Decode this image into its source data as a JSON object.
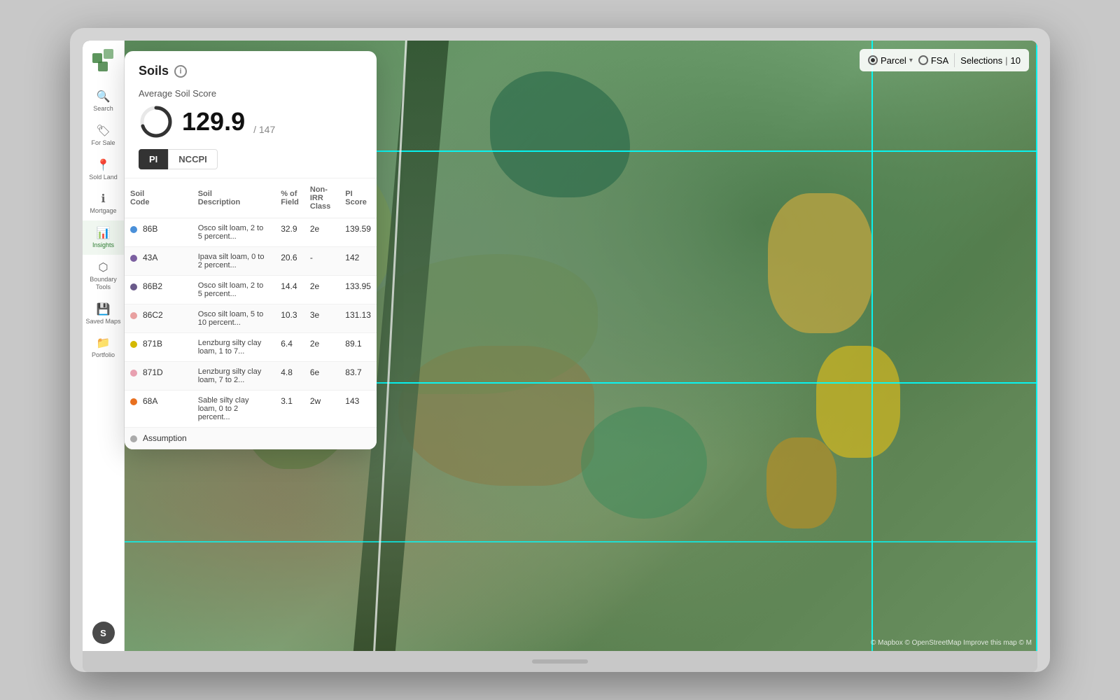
{
  "app": {
    "title": "Soils"
  },
  "sidebar": {
    "logo_label": "Logo",
    "items": [
      {
        "id": "search",
        "label": "Search",
        "icon": "🔍",
        "active": false
      },
      {
        "id": "for-sale",
        "label": "For Sale",
        "icon": "🏷",
        "active": false
      },
      {
        "id": "sold-land",
        "label": "Sold Land",
        "icon": "📍",
        "active": false
      },
      {
        "id": "mortgage",
        "label": "Mortgage",
        "icon": "ℹ",
        "active": false
      },
      {
        "id": "insights",
        "label": "Insights",
        "icon": "📊",
        "active": true
      },
      {
        "id": "boundary-tools",
        "label": "Boundary Tools",
        "icon": "⬡",
        "active": false
      },
      {
        "id": "saved-maps",
        "label": "Saved Maps",
        "icon": "💾",
        "active": false
      },
      {
        "id": "portfolio",
        "label": "Portfolio",
        "icon": "📁",
        "active": false
      }
    ],
    "avatar_label": "S"
  },
  "map_toolbar": {
    "parcel_label": "Parcel",
    "fsa_label": "FSA",
    "selections_label": "Selections",
    "selections_count": "10"
  },
  "soils_panel": {
    "title": "Soils",
    "avg_label": "Average Soil Score",
    "score": "129.9",
    "score_max": "147",
    "tabs": [
      {
        "id": "pi",
        "label": "PI",
        "active": true
      },
      {
        "id": "nccpi",
        "label": "NCCPI",
        "active": false
      }
    ],
    "table_headers": [
      "Soil Code",
      "Soil Description",
      "% of Field",
      "Non-IRR Class",
      "PI Score"
    ],
    "rows": [
      {
        "color": "#4a90d9",
        "code": "86B",
        "description": "Osco silt loam, 2 to 5 percent...",
        "percent": "32.9",
        "nonirr": "2e",
        "pi_score": "139.59"
      },
      {
        "color": "#7b5fa0",
        "code": "43A",
        "description": "Ipava silt loam, 0 to 2 percent...",
        "percent": "20.6",
        "nonirr": "-",
        "pi_score": "142"
      },
      {
        "color": "#6a5a8a",
        "code": "86B2",
        "description": "Osco silt loam, 2 to 5 percent...",
        "percent": "14.4",
        "nonirr": "2e",
        "pi_score": "133.95"
      },
      {
        "color": "#e8a0a0",
        "code": "86C2",
        "description": "Osco silt loam, 5 to 10 percent...",
        "percent": "10.3",
        "nonirr": "3e",
        "pi_score": "131.13"
      },
      {
        "color": "#d4b800",
        "code": "871B",
        "description": "Lenzburg silty clay loam, 1 to 7...",
        "percent": "6.4",
        "nonirr": "2e",
        "pi_score": "89.1"
      },
      {
        "color": "#e8a0b0",
        "code": "871D",
        "description": "Lenzburg silty clay loam, 7 to 2...",
        "percent": "4.8",
        "nonirr": "6e",
        "pi_score": "83.7"
      },
      {
        "color": "#e87020",
        "code": "68A",
        "description": "Sable silty clay loam, 0 to 2 percent...",
        "percent": "3.1",
        "nonirr": "2w",
        "pi_score": "143"
      },
      {
        "color": "#aaaaaa",
        "code": "Assumption",
        "description": "",
        "percent": "",
        "nonirr": "",
        "pi_score": ""
      }
    ]
  },
  "attribution": "© Mapbox © OpenStreetMap Improve this map © M"
}
